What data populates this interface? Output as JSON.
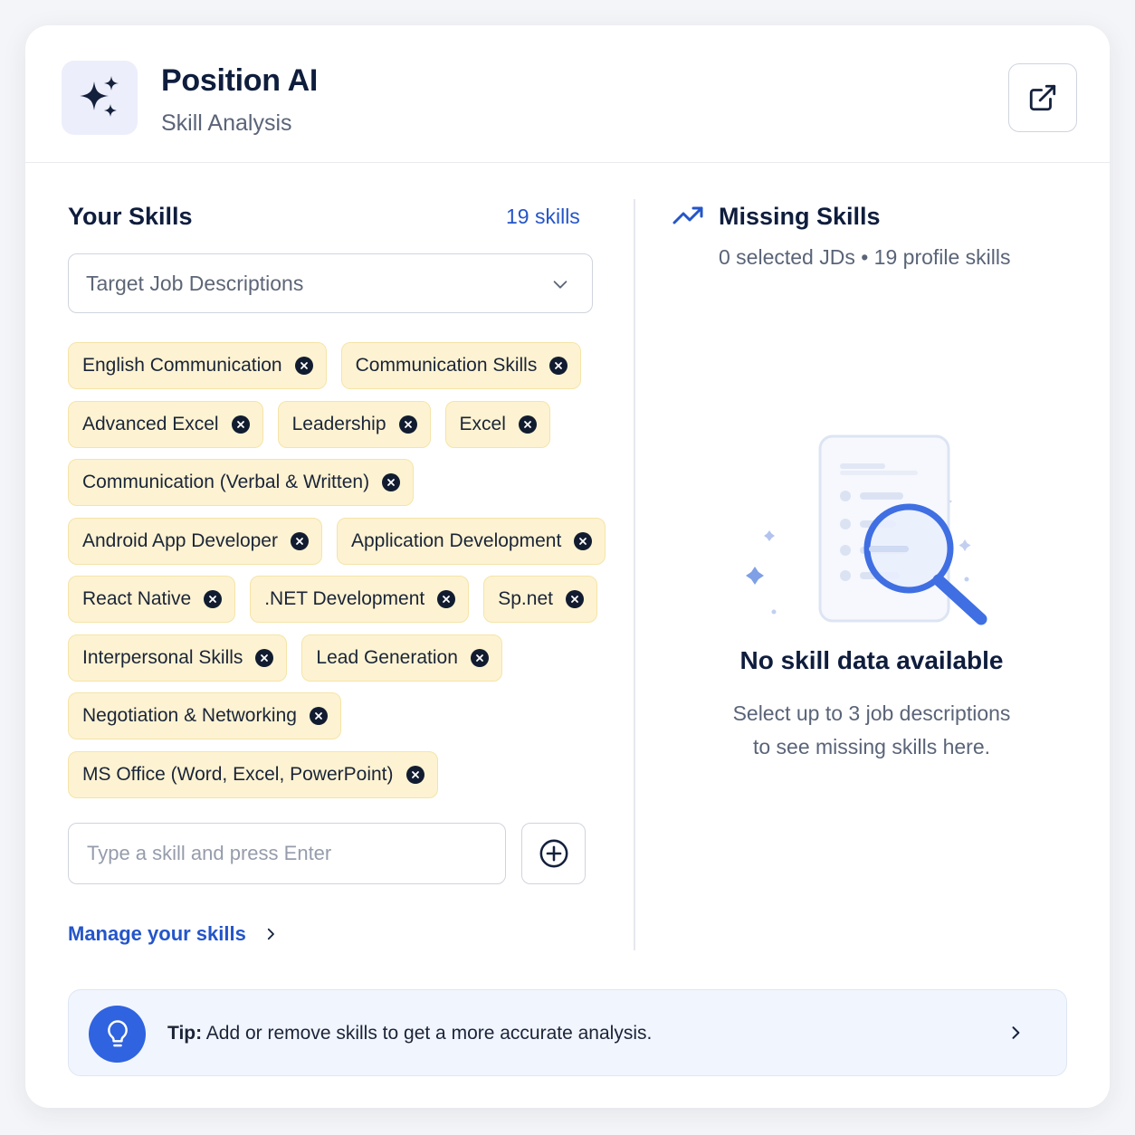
{
  "header": {
    "title": "Position AI",
    "subtitle": "Skill Analysis",
    "logo_icon": "sparkles-icon",
    "open_icon": "external-link-icon"
  },
  "your_skills": {
    "title": "Your Skills",
    "count_label": "19 skills",
    "jd_select": {
      "placeholder": "Target Job Descriptions"
    },
    "skills": [
      [
        "English Communication",
        "Communication Skills"
      ],
      [
        "Advanced Excel",
        "Leadership",
        "Excel"
      ],
      [
        "Communication (Verbal & Written)"
      ],
      [
        "Android App Developer",
        "Application Development"
      ],
      [
        "React Native",
        ".NET Development",
        "Sp.net"
      ],
      [
        "Interpersonal Skills",
        "Lead Generation"
      ],
      [
        "Negotiation & Networking"
      ],
      [
        "MS Office (Word, Excel, PowerPoint)"
      ]
    ],
    "input": {
      "placeholder": "Type a skill and press Enter"
    },
    "manage_link": "Manage your skills"
  },
  "missing_skills": {
    "title": "Missing Skills",
    "subtitle": "0 selected JDs • 19 profile skills",
    "empty_title": "No skill data available",
    "empty_desc_line1": "Select up to 3 job descriptions",
    "empty_desc_line2": "to see missing skills here."
  },
  "tip": {
    "label": "Tip:",
    "text": " Add or remove skills to get a more accurate analysis."
  },
  "colors": {
    "accent": "#2455c9",
    "chip_bg": "#fdf3d2",
    "chip_border": "#f5e4a8",
    "tip_icon_bg": "#2f63e0"
  }
}
